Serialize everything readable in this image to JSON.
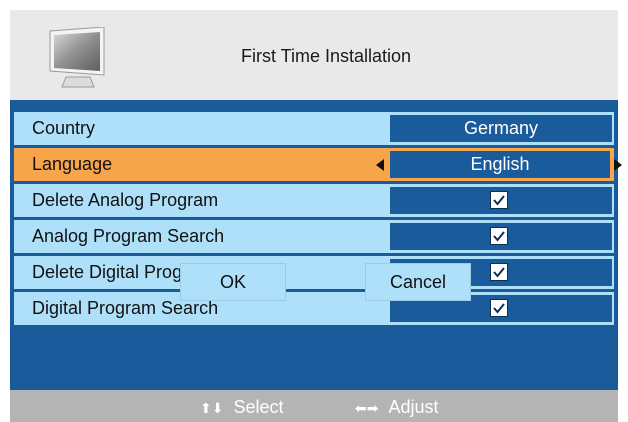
{
  "header": {
    "title": "First Time Installation",
    "icon": "tv-icon"
  },
  "rows": [
    {
      "label": "Country",
      "value": "Germany",
      "selected": false
    },
    {
      "label": "Language",
      "value": "English",
      "selected": true
    },
    {
      "label": "Delete Analog Program",
      "checked": true
    },
    {
      "label": "Analog Program Search",
      "checked": true
    },
    {
      "label": "Delete Digital Program",
      "checked": true
    },
    {
      "label": "Digital Program Search",
      "checked": true
    }
  ],
  "buttons": {
    "ok": "OK",
    "cancel": "Cancel"
  },
  "footer": {
    "select_glyph": "⬆⬇",
    "select_label": "Select",
    "adjust_glyph": "⬅➡",
    "adjust_label": "Adjust"
  },
  "colors": {
    "panel": "#1a5b9c",
    "row": "#aee0fa",
    "selected_row": "#f6a54a",
    "header": "#e9e9e9",
    "footer": "#b4b4b4"
  }
}
